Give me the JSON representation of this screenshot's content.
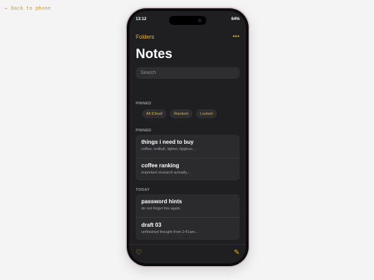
{
  "back_link": "← back to phone",
  "status": {
    "time": "13:12",
    "battery": "64%"
  },
  "nav": {
    "folders": "Folders",
    "more": "•••"
  },
  "title": "Notes",
  "search": {
    "placeholder": "Search",
    "value": ""
  },
  "folder_section": {
    "label": "PINNED",
    "chips": [
      "All iCloud",
      "Random",
      "Locked"
    ]
  },
  "pinned": {
    "label": "PINNED",
    "notes": [
      {
        "title": "things i need to buy",
        "preview": "coffee, redbull, lighter, lipgloss..."
      },
      {
        "title": "coffee ranking",
        "preview": "important research actually..."
      }
    ]
  },
  "today": {
    "label": "TODAY",
    "notes": [
      {
        "title": "password hints",
        "preview": "do not forget this again."
      },
      {
        "title": "draft 03",
        "preview": "unfinished thought from 2:41am..."
      }
    ]
  },
  "toolbar": {
    "heart_icon": "♡",
    "compose_icon": "✎"
  },
  "colors": {
    "accent": "#e7b723",
    "background": "#1f1f21",
    "card": "#2b2b2e"
  }
}
